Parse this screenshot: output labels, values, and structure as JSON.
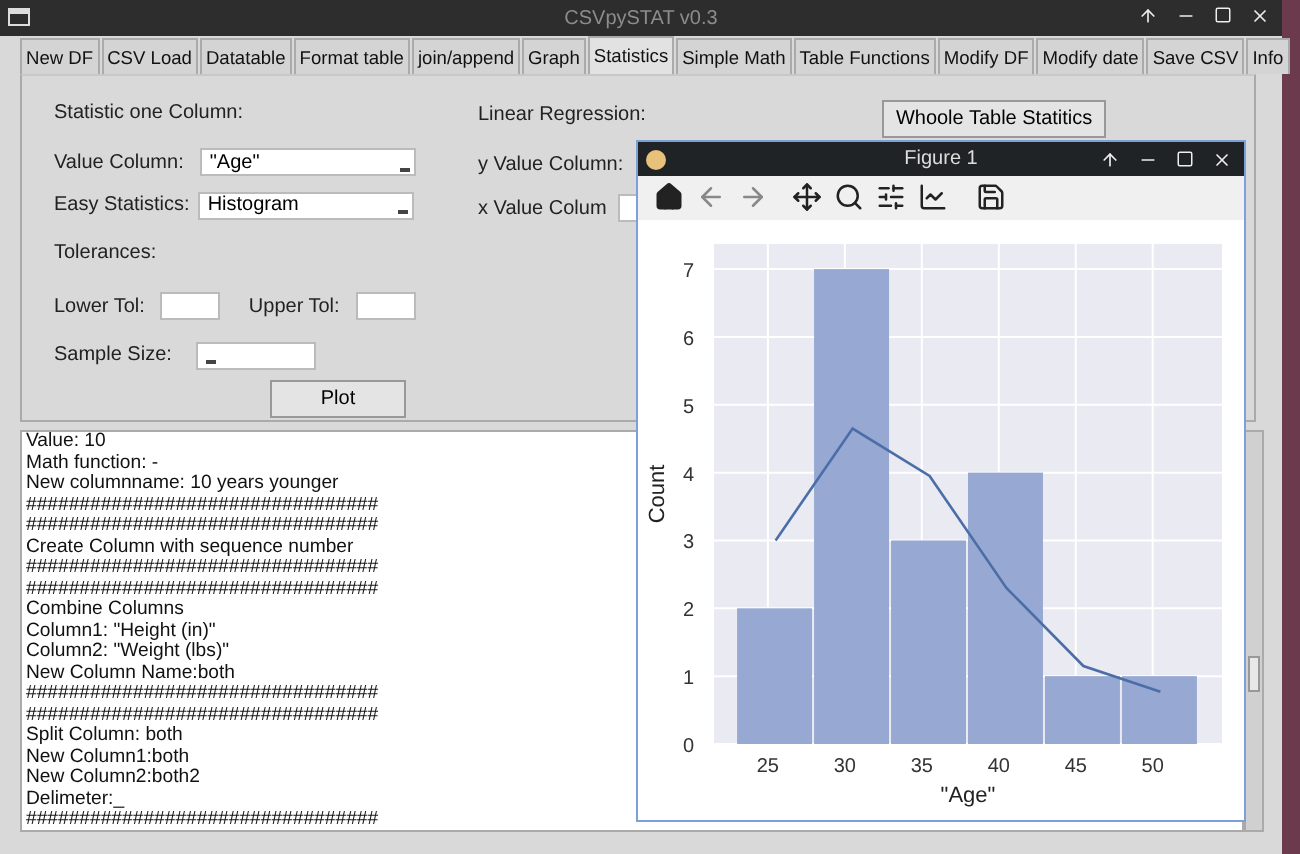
{
  "window": {
    "title": "CSVpySTAT v0.3"
  },
  "tabs": [
    {
      "label": "New DF",
      "selected": false
    },
    {
      "label": "CSV Load",
      "selected": false
    },
    {
      "label": "Datatable",
      "selected": false
    },
    {
      "label": "Format table",
      "selected": false
    },
    {
      "label": "join/append",
      "selected": false
    },
    {
      "label": "Graph",
      "selected": false
    },
    {
      "label": "Statistics",
      "selected": true
    },
    {
      "label": "Simple Math",
      "selected": false
    },
    {
      "label": "Table Functions",
      "selected": false
    },
    {
      "label": "Modify DF",
      "selected": false
    },
    {
      "label": "Modify date",
      "selected": false
    },
    {
      "label": "Save CSV",
      "selected": false
    },
    {
      "label": "Info",
      "selected": false
    }
  ],
  "statistics_panel": {
    "one_column": {
      "heading": "Statistic one Column:",
      "value_column": {
        "label": "Value Column:",
        "value": "\"Age\""
      },
      "easy_statistics": {
        "label": "Easy Statistics:",
        "value": "Histogram"
      },
      "tolerances_heading": "Tolerances:",
      "lower_tol": {
        "label": "Lower Tol:"
      },
      "upper_tol": {
        "label": "Upper Tol:"
      },
      "sample_size": {
        "label": "Sample Size:"
      },
      "plot_button": "Plot"
    },
    "linear_regression": {
      "heading": "Linear Regression:",
      "y_label": "y Value Column:",
      "x_label": "x Value Colum",
      "whole_table_button": "Whoole Table Statitics"
    }
  },
  "log": {
    "lines": [
      "Value: 10",
      "Math function: -",
      "New columnname: 10 years younger",
      "#################################",
      "#################################",
      "Create Column with sequence number",
      "#################################",
      "#################################",
      "Combine Columns",
      "Column1: \"Height (in)\"",
      "Column2: \"Weight (lbs)\"",
      "New Column Name:both",
      "#################################",
      "#################################",
      "Split Column: both",
      "New Column1:both",
      "New Column2:both2",
      "Delimeter:_",
      "#################################"
    ]
  },
  "figure_window": {
    "title": "Figure 1",
    "chart_data": {
      "type": "bar",
      "xlabel": "\"Age\"",
      "ylabel": "Count",
      "x": [
        25.5,
        30.5,
        35.5,
        40.5,
        45.5,
        50.5
      ],
      "series": [
        {
          "type": "bar",
          "color": "#97a9d2",
          "values": [
            2,
            7,
            3,
            4,
            1,
            1
          ]
        },
        {
          "type": "line",
          "color": "#4c6ea8",
          "values": [
            3.0,
            4.65,
            3.95,
            2.3,
            1.15,
            0.77
          ]
        }
      ],
      "xlim": [
        21.5,
        54.5
      ],
      "ylim": [
        0,
        7.37
      ],
      "grid": true,
      "xticks": [
        25,
        30,
        35,
        40,
        45,
        50
      ],
      "yticks": [
        0,
        1,
        2,
        3,
        4,
        5,
        6,
        7
      ]
    }
  }
}
